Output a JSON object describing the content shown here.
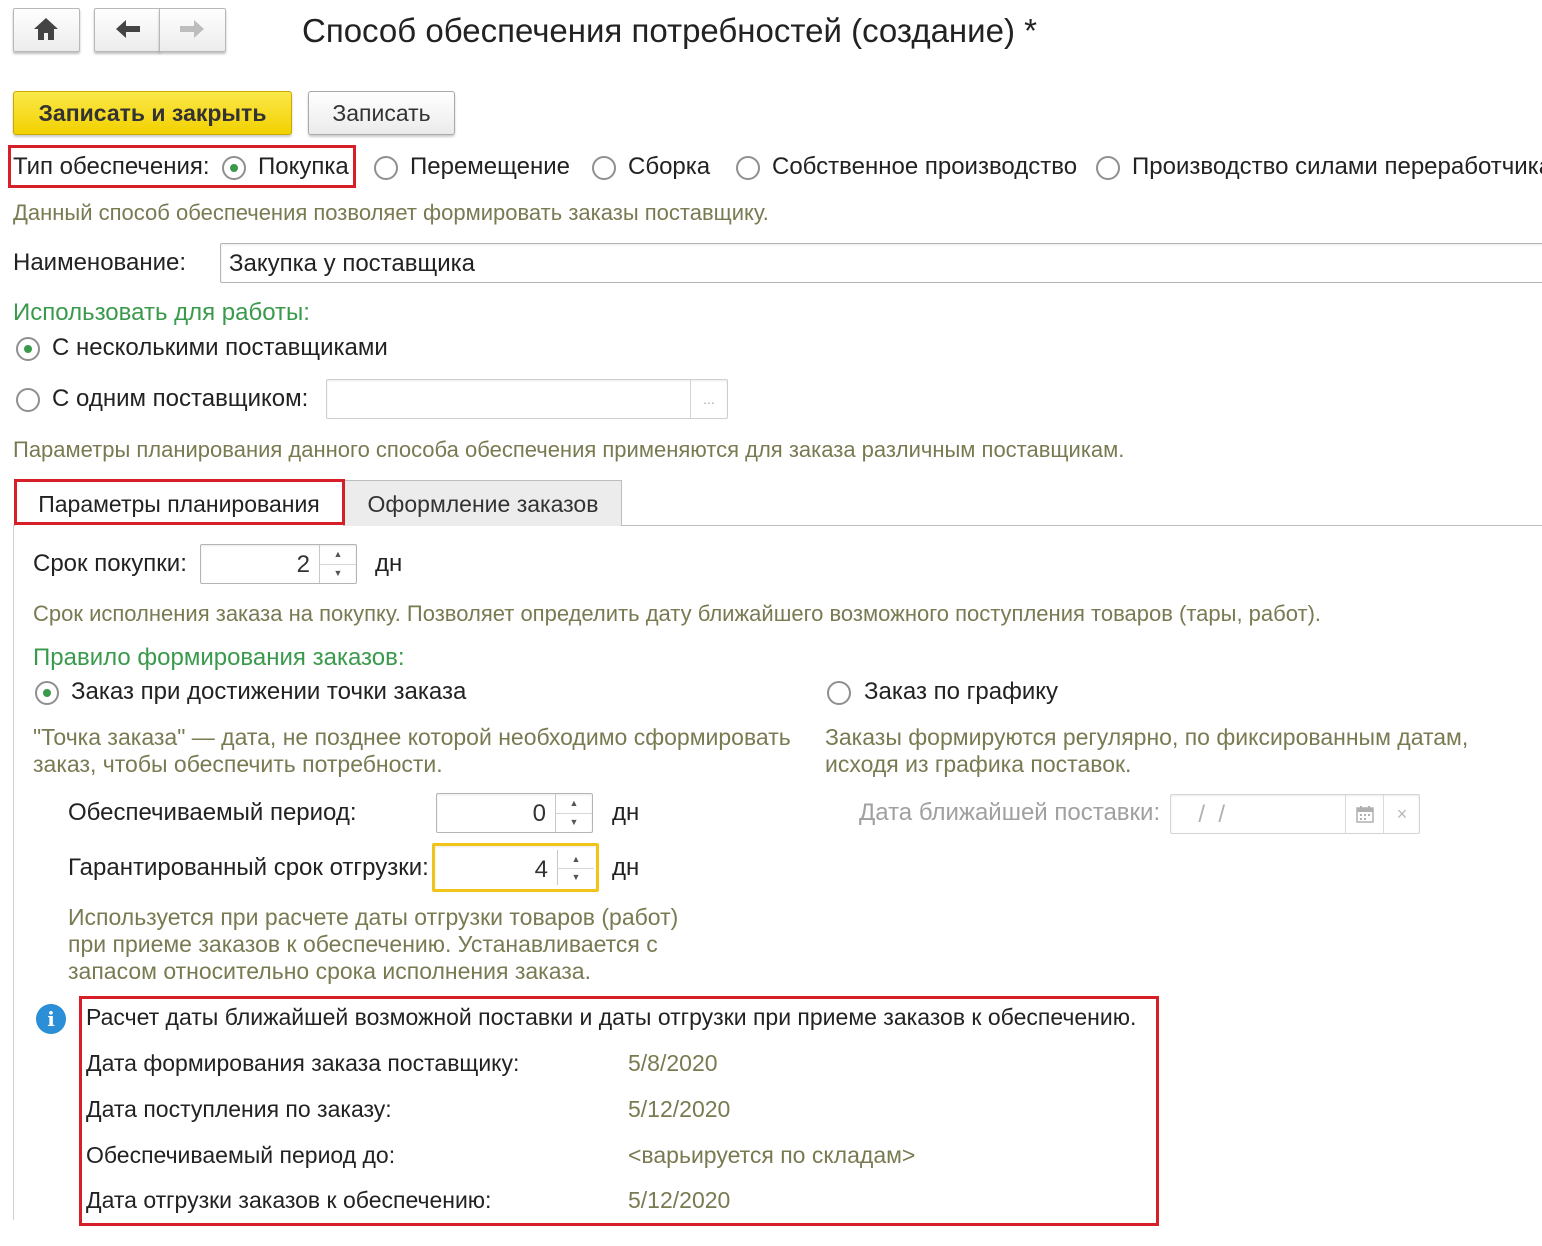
{
  "header": {
    "title": "Способ обеспечения потребностей (создание) *"
  },
  "toolbar": {
    "save_close_label": "Записать и закрыть",
    "save_label": "Записать"
  },
  "supply_type": {
    "label": "Тип обеспечения:",
    "options": [
      "Покупка",
      "Перемещение",
      "Сборка",
      "Собственное производство",
      "Производство силами переработчика"
    ],
    "selected": "Покупка",
    "hint": "Данный способ обеспечения позволяет формировать заказы поставщику."
  },
  "name_field": {
    "label": "Наименование:",
    "value": "Закупка у поставщика"
  },
  "usage": {
    "heading": "Использовать для работы:",
    "option_many": "С несколькими поставщиками",
    "option_one": "С одним поставщиком:",
    "selected": "С несколькими поставщиками",
    "supplier_value": "",
    "select_button": "...",
    "hint": "Параметры планирования данного способа обеспечения применяются для заказа различным поставщикам."
  },
  "tabs": [
    {
      "label": "Параметры планирования",
      "active": true
    },
    {
      "label": "Оформление заказов",
      "active": false
    }
  ],
  "planning": {
    "purchase_term_label": "Срок покупки:",
    "purchase_term_value": "2",
    "purchase_term_unit": "дн",
    "purchase_term_hint": "Срок исполнения заказа на покупку. Позволяет определить дату ближайшего возможного поступления товаров (тары, работ).",
    "rule_heading": "Правило формирования заказов:",
    "rule_point_label": "Заказ при достижении точки заказа",
    "rule_point_hint_1": "\"Точка заказа\" — дата, не позднее которой необходимо сформировать",
    "rule_point_hint_2": "заказ, чтобы обеспечить потребности.",
    "rule_schedule_label": "Заказ по графику",
    "rule_schedule_hint_1": "Заказы формируются регулярно, по фиксированным датам,",
    "rule_schedule_hint_2": "исходя из графика поставок.",
    "rule_selected": "Заказ при достижении точки заказа",
    "period_label": "Обеспечиваемый период:",
    "period_value": "0",
    "period_unit": "дн",
    "nearest_delivery_label": "Дата ближайшей поставки:",
    "nearest_delivery_value": "  /  /",
    "guaranteed_label": "Гарантированный срок отгрузки:",
    "guaranteed_value": "4",
    "guaranteed_unit": "дн",
    "guaranteed_hint_1": "Используется при расчете даты отгрузки товаров (работ)",
    "guaranteed_hint_2": "при приеме заказов к обеспечению. Устанавливается с",
    "guaranteed_hint_3": "запасом относительно срока исполнения заказа."
  },
  "info": {
    "title": "Расчет даты ближайшей возможной поставки и даты отгрузки при приеме заказов к обеспечению.",
    "rows": [
      {
        "label": "Дата формирования заказа поставщику:",
        "value": "5/8/2020"
      },
      {
        "label": "Дата поступления по заказу:",
        "value": "5/12/2020"
      },
      {
        "label": "Обеспечиваемый период до:",
        "value": "<варьируется по складам>"
      },
      {
        "label": "Дата отгрузки заказов к обеспечению:",
        "value": "5/12/2020"
      }
    ]
  },
  "colors": {
    "accent_green": "#3a9a4c",
    "primary_yellow": "#f2d100",
    "highlight_red": "#d71f2a",
    "focus_yellow": "#f0c419",
    "info_blue": "#2a8fd6"
  }
}
